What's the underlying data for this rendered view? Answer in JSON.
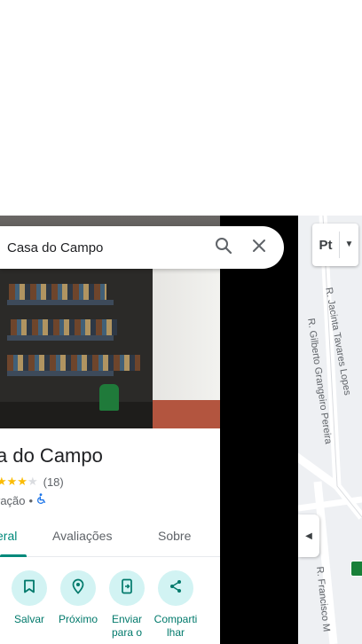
{
  "search": {
    "query": "Casa do Campo"
  },
  "place": {
    "title": "a do Campo",
    "rating_count": "(18)",
    "stars_filled": 3,
    "stars_empty": 1,
    "category": "ração",
    "separator": "•"
  },
  "tabs": [
    {
      "label": "eral",
      "active": true
    },
    {
      "label": "Avaliações",
      "active": false
    },
    {
      "label": "Sobre",
      "active": false
    }
  ],
  "actions": [
    {
      "label_line1": "Salvar",
      "label_line2": "",
      "icon": "bookmark-icon"
    },
    {
      "label_line1": "Próximo",
      "label_line2": "",
      "icon": "nearby-icon"
    },
    {
      "label_line1": "Enviar",
      "label_line2": "para o",
      "icon": "send-to-phone-icon"
    },
    {
      "label_line1": "Comparti",
      "label_line2": "lhar",
      "icon": "share-icon"
    }
  ],
  "map": {
    "layer_label": "Pt",
    "streets": [
      "R. Jacinta Tavares Lopes",
      "R. Gilberto Grangeiro Pereira",
      "R. Francisco M"
    ]
  },
  "colors": {
    "accent": "#00897b",
    "action_bg": "#d2f3f3",
    "star": "#fbbc04"
  }
}
